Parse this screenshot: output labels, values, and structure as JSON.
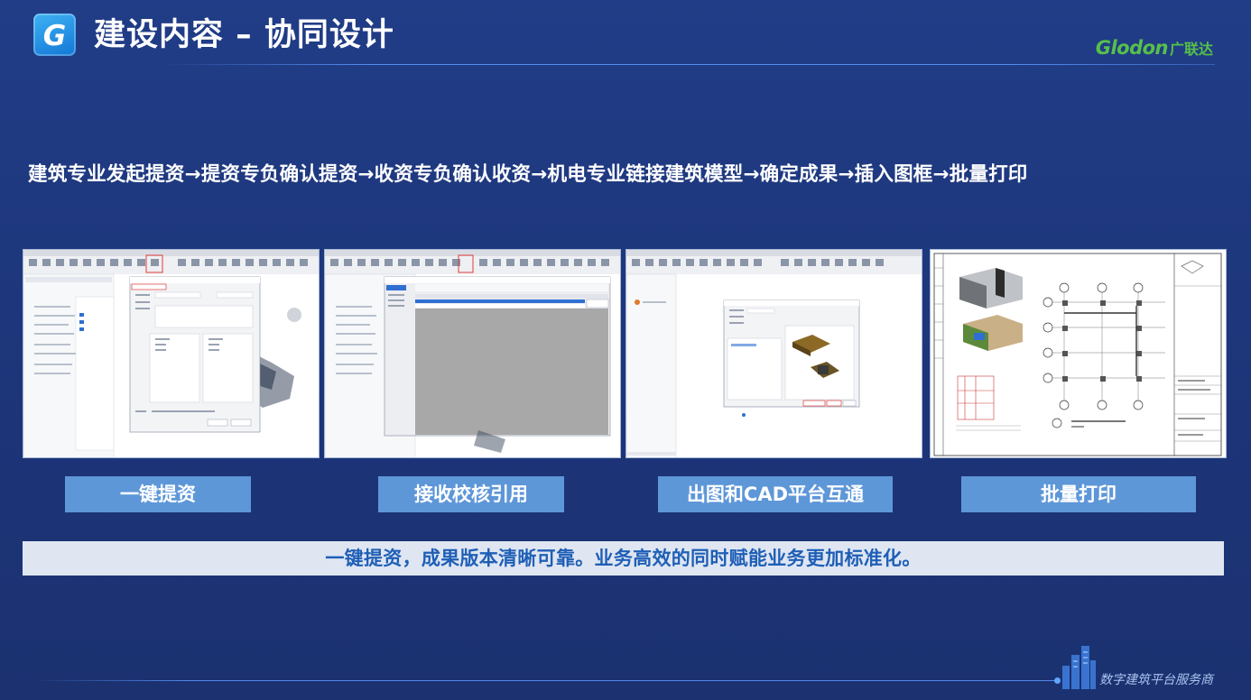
{
  "header": {
    "logo_letter": "G",
    "title": "建设内容 – 协同设计",
    "brand_wordmark": "Glodon",
    "brand_cn": "广联达"
  },
  "flow": "建筑专业发起提资→提资专负确认提资→收资专负确认收资→机电专业链接建筑模型→确定成果→插入图框→批量打印",
  "panels": [
    {
      "caption": "一键提资"
    },
    {
      "caption": "接收校核引用"
    },
    {
      "caption": "出图和CAD平台互通"
    },
    {
      "caption": "批量打印"
    }
  ],
  "summary": "一键提资，成果版本清晰可靠。业务高效的同时赋能业务更加标准化。",
  "footer": {
    "tagline": "数字建筑平台服务商"
  },
  "colors": {
    "background": "#1d3579",
    "caption_bg": "#5e97d8",
    "summary_bg": "#dfe6f2",
    "summary_text": "#1f5fb6",
    "brand_green": "#56c04a"
  }
}
